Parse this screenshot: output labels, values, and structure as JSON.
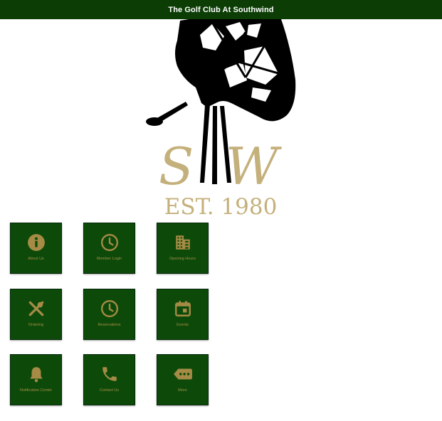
{
  "header": {
    "title": "The Golf Club At Southwind"
  },
  "logo": {
    "monogram_left": "S",
    "monogram_right": "W",
    "established": "EST. 1980"
  },
  "colors": {
    "header_bg": "#0b3d05",
    "tile_bg": "#0d4a0a",
    "gold": "#a58b45",
    "logo_gold": "#c4b07a"
  },
  "tiles": [
    {
      "label": "About Us",
      "icon": "info-icon"
    },
    {
      "label": "Member Login",
      "icon": "clock-icon"
    },
    {
      "label": "Opening Hours",
      "icon": "building-icon"
    },
    {
      "label": "Ordering",
      "icon": "utensils-icon"
    },
    {
      "label": "Reservations",
      "icon": "clock-icon"
    },
    {
      "label": "Events",
      "icon": "calendar-icon"
    },
    {
      "label": "Notification Center",
      "icon": "bell-icon"
    },
    {
      "label": "Contact Us",
      "icon": "phone-icon"
    },
    {
      "label": "More",
      "icon": "more-tag-icon"
    }
  ]
}
